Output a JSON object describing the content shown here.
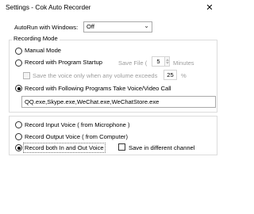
{
  "window": {
    "title": "Settings - Cok Auto Recorder",
    "close_glyph": "✕"
  },
  "autorun": {
    "label": "AutoRun with Windows:",
    "value": "Off",
    "options": [
      "Off"
    ]
  },
  "recording_mode": {
    "legend": "Recording Mode",
    "manual_label": "Manual Mode",
    "manual_selected": false,
    "startup_label": "Record with Program Startup",
    "startup_selected": false,
    "save_file_label": "Save File (",
    "save_file_value": "5",
    "minutes_label": "Minutes",
    "volume_label": "Save the voice only when any volume exceeds",
    "volume_value": "25",
    "percent_label": "%",
    "following_label": "Record with Following Programs Take Voice/Video Call",
    "following_selected": true,
    "programs": "QQ.exe,Skype.exe,WeChat.exe,WeChatStore.exe"
  },
  "voice_source": {
    "input_label": "Record Input Voice ( from Microphone )",
    "input_selected": false,
    "output_label": "Record Output Voice ( from Computer)",
    "output_selected": false,
    "both_label": "Record both In and Out Voice",
    "both_selected": true,
    "separate_label": "Save in different channel",
    "separate_checked": false
  }
}
